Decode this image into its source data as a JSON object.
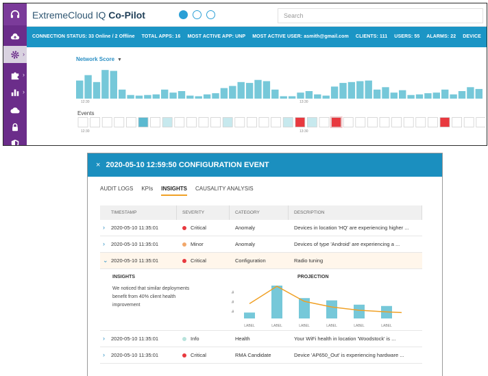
{
  "app": {
    "brand_prefix": "ExtremeCloud IQ ",
    "brand_bold": "Co-Pilot",
    "search_placeholder": "Search",
    "status": [
      "CONNECTION STATUS: 33 Online / 2 Offline",
      "TOTAL APPS: 16",
      "MOST ACTIVE APP: UNP",
      "MOST ACTIVE USER: asmith@gmail.com",
      "CLIENTS: 111",
      "USERS: 55",
      "ALARMS: 22",
      "DEVICE"
    ],
    "rail_icons": [
      "headset-icon",
      "cloud-upload-icon",
      "gear-icon",
      "puzzle-icon",
      "bar-chart-icon",
      "cloud-icon",
      "lock-icon",
      "shield-icon"
    ]
  },
  "network": {
    "selector_label": "Network Score",
    "time_ticks": [
      "12:30",
      "13:30"
    ],
    "scores": [
      0.6,
      0.78,
      0.55,
      0.95,
      0.92,
      0.3,
      0.12,
      0.1,
      0.12,
      0.14,
      0.3,
      0.2,
      0.25,
      0.1,
      0.08,
      0.14,
      0.18,
      0.35,
      0.42,
      0.55,
      0.52,
      0.62,
      0.58,
      0.3,
      0.08,
      0.08,
      0.2,
      0.25,
      0.14,
      0.1,
      0.4,
      0.52,
      0.55,
      0.58,
      0.6,
      0.3,
      0.38,
      0.2,
      0.28,
      0.12,
      0.14,
      0.18,
      0.2,
      0.3,
      0.14,
      0.25,
      0.38,
      0.32
    ],
    "events_label": "Events",
    "event_ticks": [
      "12:30",
      "13:30"
    ],
    "events": [
      "none",
      "none",
      "none",
      "none",
      "none",
      "info",
      "none",
      "light",
      "none",
      "none",
      "none",
      "none",
      "light",
      "none",
      "none",
      "none",
      "none",
      "light",
      "critical",
      "light",
      "none",
      "critical-selected",
      "none",
      "none",
      "none",
      "none",
      "none",
      "none",
      "none",
      "none",
      "critical",
      "none",
      "none",
      "none",
      "none"
    ]
  },
  "modal": {
    "close_label": "×",
    "title": "2020-05-10 12:59:50  CONFIGURATION EVENT",
    "tabs": [
      "AUDIT LOGS",
      "KPIs",
      "INSIGHTS",
      "CAUSALITY ANALYSIS"
    ],
    "active_tab": "INSIGHTS",
    "columns": [
      "TIMESTAMP",
      "SEVERITY",
      "CATEGORY",
      "DESCRIPTION"
    ],
    "rows": [
      {
        "timestamp": "2020-05-10 11:35:01",
        "severity": "Critical",
        "category": "Anomaly",
        "description": "Devices in location 'HQ' are experiencing higher ..."
      },
      {
        "timestamp": "2020-05-10 11:35:01",
        "severity": "Minor",
        "category": "Anomaly",
        "description": "Devices of type 'Android' are experiencing a ..."
      },
      {
        "timestamp": "2020-05-10 11:35:01",
        "severity": "Critical",
        "category": "Configuration",
        "description": "Radio tuning"
      },
      {
        "timestamp": "2020-05-10 11:35:01",
        "severity": "Info",
        "category": "Health",
        "description": "Your WiFi health in location 'Woodstock' is ..."
      },
      {
        "timestamp": "2020-05-10 11:35:01",
        "severity": "Critical",
        "category": "RMA Candidate",
        "description": "Device 'AP650_Out' is experiencing hardware ..."
      }
    ],
    "severity_colors": {
      "Critical": "#e8393f",
      "Minor": "#f2a86b",
      "Info": "#b7e3dc"
    },
    "insights": {
      "title": "INSIGHTS",
      "text": "We noticed that similar deployments benefit from 40% client health improvement",
      "projection_title": "PROJECTION",
      "y_tick": "#",
      "x_label": "LABEL"
    }
  },
  "chart_data": {
    "type": "bar",
    "categories": [
      "LABEL",
      "LABEL",
      "LABEL",
      "LABEL",
      "LABEL",
      "LABEL"
    ],
    "series": [
      {
        "type": "bar",
        "values": [
          0.18,
          1.0,
          0.62,
          0.55,
          0.42,
          0.38
        ]
      },
      {
        "type": "line",
        "values": [
          0.45,
          0.98,
          0.52,
          0.35,
          0.25,
          0.2
        ]
      }
    ],
    "title": "PROJECTION"
  }
}
